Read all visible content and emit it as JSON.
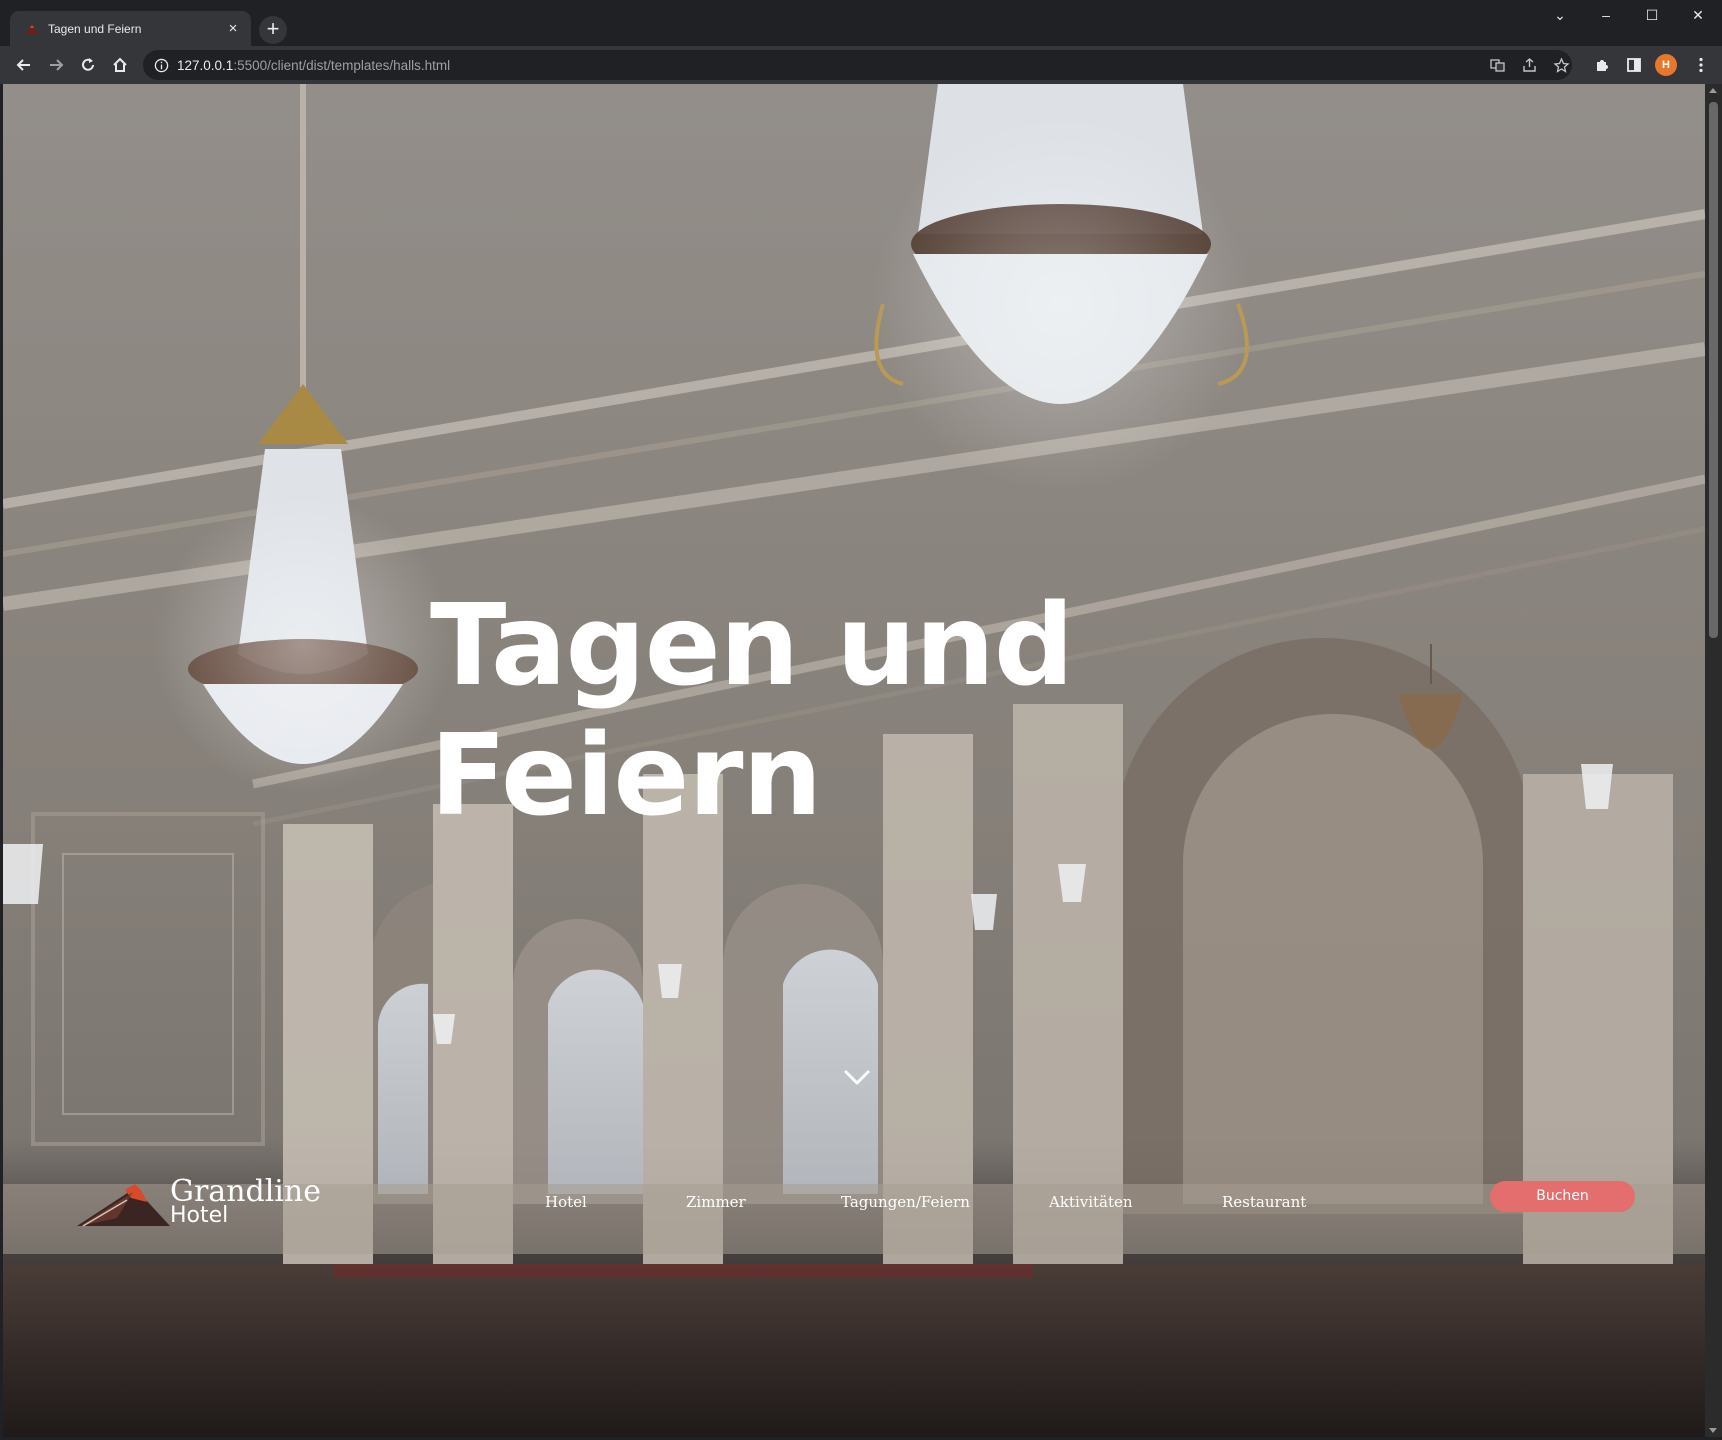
{
  "browser": {
    "tab_title": "Tagen und Feiern",
    "tab_close": "×",
    "new_tab": "+",
    "url_host": "127.0.0.1",
    "url_rest": ":5500/client/dist/templates/halls.html",
    "profile_initial": "H",
    "window_controls": {
      "dropdown": "⌄",
      "minimize": "–",
      "maximize": "☐",
      "close": "✕"
    }
  },
  "hero": {
    "title_line1": "Tagen und",
    "title_line2": "Feiern",
    "scroll_icon": "chevron-down-icon"
  },
  "site_nav": {
    "logo_word": "Grandline",
    "logo_sub": "Hotel",
    "links": [
      {
        "label": "Hotel"
      },
      {
        "label": "Zimmer"
      },
      {
        "label": "Tagungen/Feiern"
      },
      {
        "label": "Aktivitäten"
      },
      {
        "label": "Restaurant"
      }
    ],
    "book_label": "Buchen"
  },
  "colors": {
    "chrome_dark": "#202124",
    "chrome_mid": "#35363a",
    "accent_button": "#e46d6d",
    "profile": "#e8772e"
  }
}
